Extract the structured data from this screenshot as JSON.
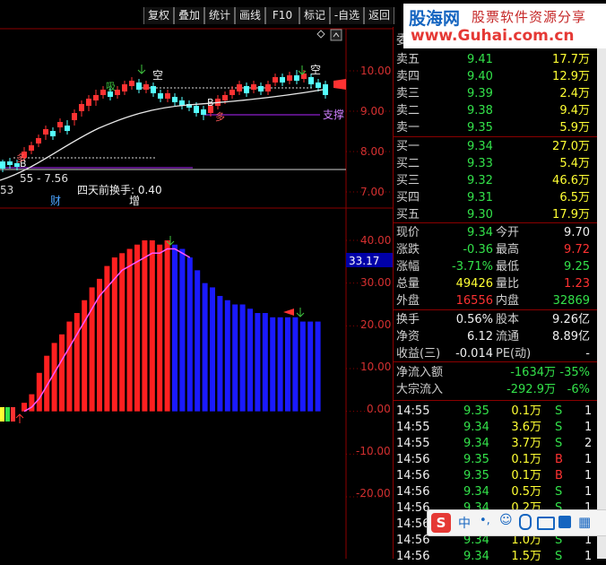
{
  "toolbar": {
    "buttons": [
      "复权",
      "叠加",
      "统计",
      "画线",
      "F10",
      "标记",
      "-自选",
      "返回"
    ]
  },
  "brand": {
    "logo": "股海网",
    "slogan": "股票软件资源分享",
    "url": "www.Guhai.com.cn"
  },
  "main_chart": {
    "price_ticks": [
      "10.00",
      "9.00",
      "8.00",
      "7.00"
    ],
    "support_label": "支撑",
    "empty_label": "空",
    "low_label": "53",
    "range_label": "55 - 7.56",
    "turnover_label": "四天前换手: 0.40",
    "cai_label": "财",
    "zeng_label": "增",
    "buy_label": "B",
    "xi_label": "吸",
    "duo_label": "多"
  },
  "sub_chart": {
    "ticks": [
      "40.00",
      "30.00",
      "20.00",
      "10.00",
      "0.00",
      "-10.00",
      "-20.00"
    ],
    "current_value": "33.17"
  },
  "chart_data": {
    "type": "bar",
    "ylim": [
      -20,
      40
    ],
    "gridlines": true,
    "values": [
      2,
      4,
      9,
      13,
      16,
      18,
      21,
      23,
      26,
      29,
      31,
      34,
      36,
      37,
      38,
      39,
      40,
      40,
      39,
      40,
      39,
      38,
      36,
      33,
      30,
      29,
      27,
      26,
      25,
      25,
      24,
      23,
      23,
      22,
      22,
      22,
      22,
      21,
      21,
      21
    ],
    "line_values": [
      0,
      1,
      3,
      6,
      9,
      12,
      15,
      18,
      21,
      24,
      27,
      29,
      31,
      33,
      34,
      35,
      36,
      37,
      37,
      38,
      38,
      37,
      36
    ]
  },
  "quote": {
    "header": "委",
    "sell": [
      {
        "label": "卖五",
        "price": "9.41",
        "vol": "17.7万"
      },
      {
        "label": "卖四",
        "price": "9.40",
        "vol": "12.9万"
      },
      {
        "label": "卖三",
        "price": "9.39",
        "vol": "2.4万"
      },
      {
        "label": "卖二",
        "price": "9.38",
        "vol": "9.4万"
      },
      {
        "label": "卖一",
        "price": "9.35",
        "vol": "5.9万"
      }
    ],
    "buy": [
      {
        "label": "买一",
        "price": "9.34",
        "vol": "27.0万"
      },
      {
        "label": "买二",
        "price": "9.33",
        "vol": "5.4万"
      },
      {
        "label": "买三",
        "price": "9.32",
        "vol": "46.6万"
      },
      {
        "label": "买四",
        "price": "9.31",
        "vol": "6.5万"
      },
      {
        "label": "买五",
        "price": "9.30",
        "vol": "17.9万"
      }
    ],
    "stats": [
      {
        "l1": "现价",
        "v1": "9.34",
        "c1": "green",
        "l2": "今开",
        "v2": "9.70",
        "c2": "white"
      },
      {
        "l1": "涨跌",
        "v1": "-0.36",
        "c1": "green",
        "l2": "最高",
        "v2": "9.72",
        "c2": "red"
      },
      {
        "l1": "涨幅",
        "v1": "-3.71%",
        "c1": "green",
        "l2": "最低",
        "v2": "9.25",
        "c2": "green"
      },
      {
        "l1": "总量",
        "v1": "49426",
        "c1": "yellow",
        "l2": "量比",
        "v2": "1.23",
        "c2": "red"
      },
      {
        "l1": "外盘",
        "v1": "16556",
        "c1": "red",
        "l2": "内盘",
        "v2": "32869",
        "c2": "green"
      }
    ],
    "fund": [
      {
        "l1": "换手",
        "v1": "0.56%",
        "l2": "股本",
        "v2": "9.26亿"
      },
      {
        "l1": "净资",
        "v1": "6.12",
        "l2": "流通",
        "v2": "8.89亿"
      },
      {
        "l1": "收益(三)",
        "v1": "-0.014",
        "l2": "PE(动)",
        "v2": "-"
      }
    ],
    "flow": [
      {
        "label": "净流入额",
        "v1": "-1634万",
        "v2": "-35%"
      },
      {
        "label": "大宗流入",
        "v1": "-292.9万",
        "v2": "-6%"
      }
    ],
    "ticks": [
      {
        "t": "14:55",
        "p": "9.35",
        "v": "0.1万",
        "s": "S",
        "n": "1",
        "pc": "green",
        "sc": "green"
      },
      {
        "t": "14:55",
        "p": "9.34",
        "v": "3.6万",
        "s": "S",
        "n": "1",
        "pc": "green",
        "sc": "green"
      },
      {
        "t": "14:55",
        "p": "9.34",
        "v": "3.7万",
        "s": "S",
        "n": "2",
        "pc": "green",
        "sc": "green"
      },
      {
        "t": "14:56",
        "p": "9.35",
        "v": "0.1万",
        "s": "B",
        "n": "1",
        "pc": "green",
        "sc": "red"
      },
      {
        "t": "14:56",
        "p": "9.35",
        "v": "0.1万",
        "s": "B",
        "n": "1",
        "pc": "green",
        "sc": "red"
      },
      {
        "t": "14:56",
        "p": "9.34",
        "v": "0.5万",
        "s": "S",
        "n": "1",
        "pc": "green",
        "sc": "green"
      },
      {
        "t": "14:56",
        "p": "9.34",
        "v": "0.2万",
        "s": "S",
        "n": "1",
        "pc": "green",
        "sc": "green"
      },
      {
        "t": "14:56",
        "p": "9.34",
        "v": "",
        "s": "",
        "n": "",
        "pc": "green",
        "sc": "green"
      },
      {
        "t": "14:56",
        "p": "9.34",
        "v": "1.0万",
        "s": "S",
        "n": "1",
        "pc": "green",
        "sc": "green"
      },
      {
        "t": "14:56",
        "p": "9.34",
        "v": "1.5万",
        "s": "S",
        "n": "1",
        "pc": "green",
        "sc": "green"
      }
    ]
  },
  "ime": {
    "label": "中"
  }
}
